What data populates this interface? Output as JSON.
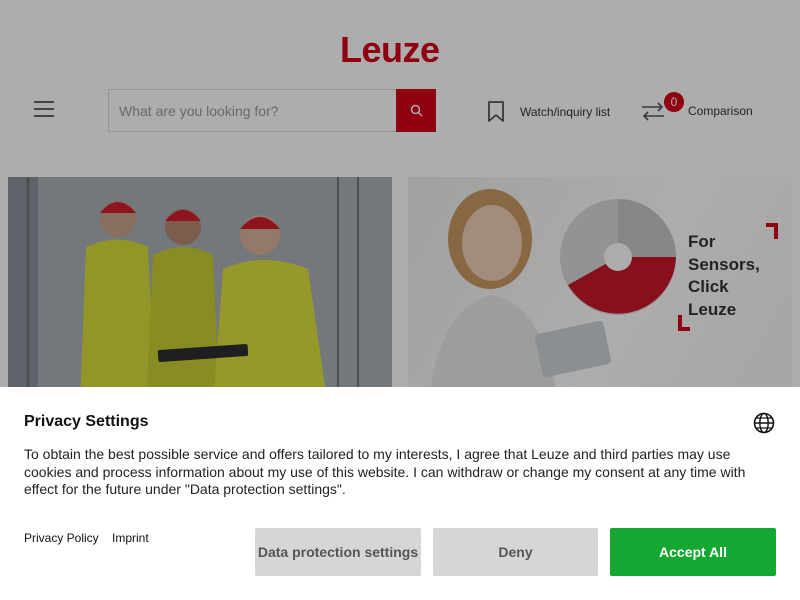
{
  "header": {
    "logo_text": "Leuze",
    "search": {
      "placeholder": "What are you looking for?",
      "value": ""
    },
    "watchlist_label": "Watch/inquiry list",
    "comparison_label": "Comparison",
    "comparison_count": "0"
  },
  "banners": {
    "promo_lines": [
      "For",
      "Sensors,",
      "Click",
      "Leuze"
    ]
  },
  "privacy": {
    "title": "Privacy Settings",
    "text": "To obtain the best possible service and offers tailored to my interests, I agree that Leuze and third parties may use cookies and process information about my use of this website. I can withdraw or change my consent at any time with effect for the future under \"Data protection settings\".",
    "links": {
      "policy": "Privacy Policy",
      "imprint": "Imprint"
    },
    "buttons": {
      "settings": "Data protection settings",
      "deny": "Deny",
      "accept": "Accept All"
    }
  },
  "colors": {
    "brand": "#d4001a",
    "accept": "#14a832",
    "secondary_button": "#d6d6d6"
  },
  "icons": [
    "menu-icon",
    "search-icon",
    "bookmark-icon",
    "compare-arrows-icon",
    "globe-icon"
  ]
}
